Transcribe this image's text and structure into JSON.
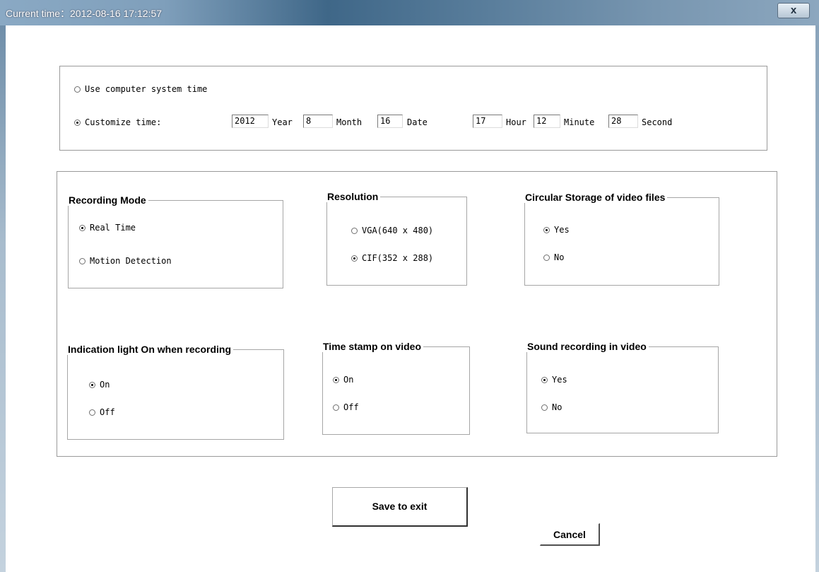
{
  "window": {
    "title": "Current time：2012-08-16   17:12:57",
    "close_label": "x"
  },
  "time_settings": {
    "use_system_time_label": "Use computer system time",
    "customize_label": "Customize time:",
    "use_system_selected": false,
    "customize_selected": true,
    "fields": [
      {
        "name": "year",
        "value": "2012",
        "label": "Year"
      },
      {
        "name": "month",
        "value": "8",
        "label": "Month"
      },
      {
        "name": "date",
        "value": "16",
        "label": "Date"
      },
      {
        "name": "hour",
        "value": "17",
        "label": "Hour"
      },
      {
        "name": "minute",
        "value": "12",
        "label": "Minute"
      },
      {
        "name": "second",
        "value": "28",
        "label": "Second"
      }
    ]
  },
  "recording_mode": {
    "title": "Recording Mode",
    "options": [
      {
        "label": "Real Time",
        "selected": true
      },
      {
        "label": "Motion Detection",
        "selected": false
      }
    ]
  },
  "resolution": {
    "title": "Resolution",
    "options": [
      {
        "label": "VGA(640 x 480)",
        "selected": false
      },
      {
        "label": "CIF(352 x 288)",
        "selected": true
      }
    ]
  },
  "circular_storage": {
    "title": "Circular Storage of video files",
    "options": [
      {
        "label": "Yes",
        "selected": true
      },
      {
        "label": "No",
        "selected": false
      }
    ]
  },
  "indication_light": {
    "title": "Indication light On when recording",
    "options": [
      {
        "label": "On",
        "selected": true
      },
      {
        "label": "Off",
        "selected": false
      }
    ]
  },
  "time_stamp": {
    "title": "Time stamp on video",
    "options": [
      {
        "label": "On",
        "selected": true
      },
      {
        "label": "Off",
        "selected": false
      }
    ]
  },
  "sound_recording": {
    "title": "Sound recording in video",
    "options": [
      {
        "label": "Yes",
        "selected": true
      },
      {
        "label": "No",
        "selected": false
      }
    ]
  },
  "buttons": {
    "save_label": "Save to exit",
    "cancel_label": "Cancel"
  }
}
